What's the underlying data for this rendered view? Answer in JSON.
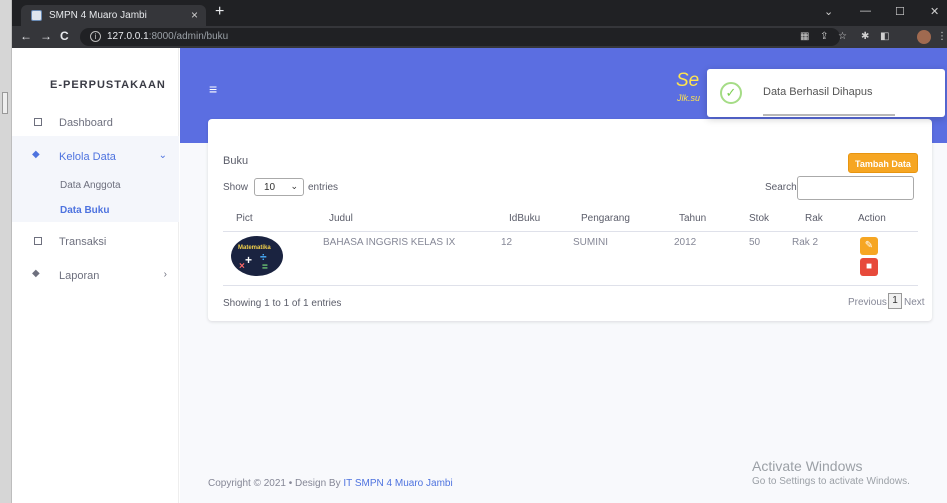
{
  "browser": {
    "tab_title": "SMPN 4 Muaro Jambi",
    "tab_close": "×",
    "new_tab": "+",
    "url_host": "127.0.0.1",
    "url_rest": ":8000/admin/buku",
    "win_min": "—",
    "win_max": "☐",
    "win_close": "✕",
    "win_menu": "⌄"
  },
  "sidebar": {
    "brand": "E-PERPUSTAKAAN",
    "items": [
      {
        "label": "Dashboard"
      },
      {
        "label": "Kelola Data"
      },
      {
        "label": "Transaksi"
      },
      {
        "label": "Laporan"
      }
    ],
    "sub_items": [
      {
        "label": "Data Anggota"
      },
      {
        "label": "Data Buku"
      }
    ]
  },
  "topbar": {
    "menu_icon": "≡",
    "brand_partial": "Se",
    "brand_sub_partial": "Jlk.su"
  },
  "card": {
    "title": "Buku",
    "add_button": "Tambah Data",
    "show_label": "Show",
    "show_value": "10",
    "entries_label": "entries",
    "search_label": "Search:",
    "search_value": "",
    "columns": [
      "Pict",
      "Judul",
      "IdBuku",
      "Pengarang",
      "Tahun",
      "Stok",
      "Rak",
      "Action"
    ],
    "rows": [
      {
        "pict_text": "Matematika",
        "judul": "BAHASA INGGRIS KELAS IX",
        "idbuku": "12",
        "pengarang": "SUMINI",
        "tahun": "2012",
        "stok": "50",
        "rak": "Rak 2"
      }
    ],
    "showing": "Showing 1 to 1 of 1 entries",
    "pager": {
      "prev": "Previous",
      "page": "1",
      "next": "Next"
    }
  },
  "footer": {
    "text": "Copyright © 2021 • Design By ",
    "link": "IT SMPN 4 Muaro Jambi"
  },
  "watermark": {
    "line1": "Activate Windows",
    "line2": "Go to Settings to activate Windows."
  },
  "toast": {
    "message": "Data Berhasil Dihapus"
  },
  "colors": {
    "primary": "#4e73df",
    "topbar": "#5b6ee1",
    "warning": "#f6a623",
    "danger": "#e74a3b",
    "success": "#a5dc86"
  }
}
